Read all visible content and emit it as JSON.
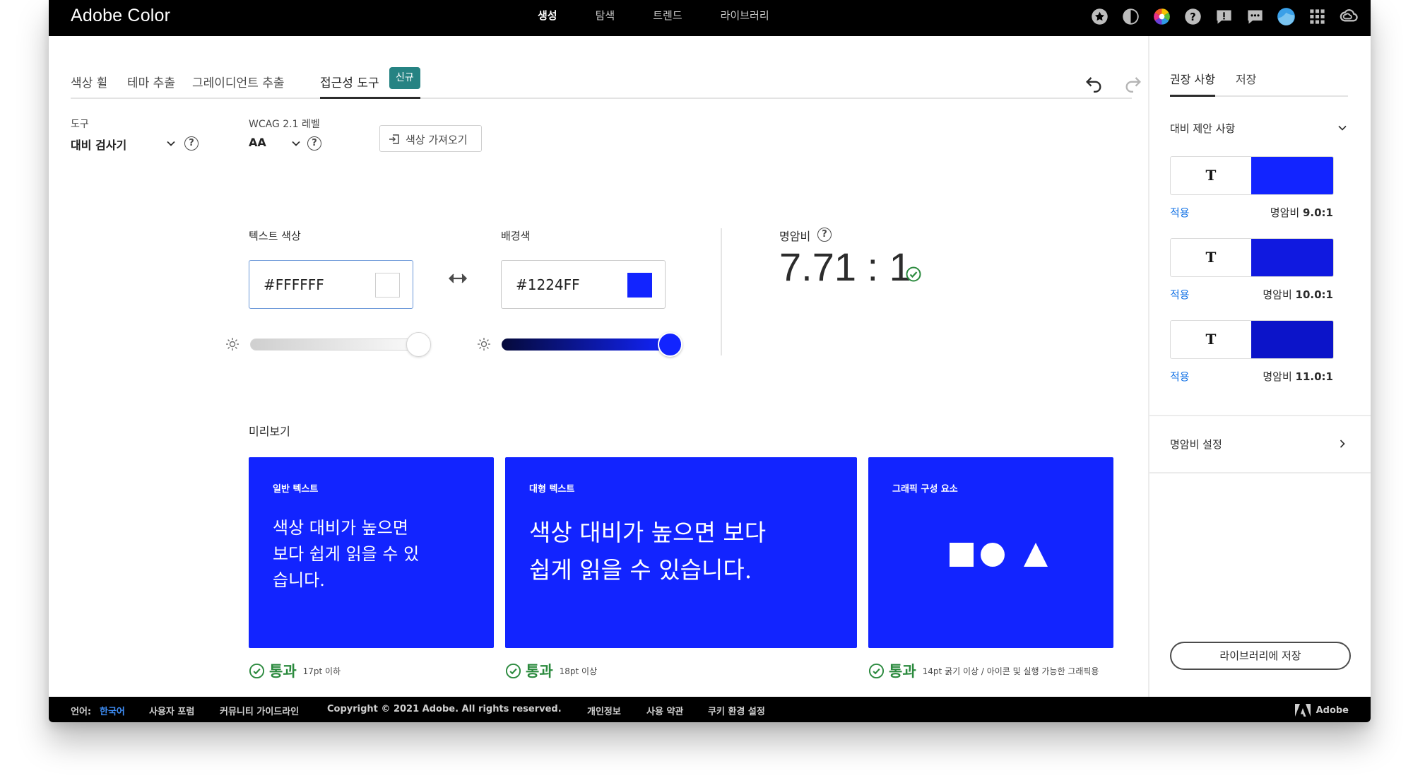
{
  "app": {
    "title": "Adobe Color"
  },
  "topnav": [
    "생성",
    "탐색",
    "트렌드",
    "라이브러리"
  ],
  "topicons": [
    "star-badge-icon",
    "contrast-icon",
    "color-wheel-icon",
    "help-icon",
    "feedback-alert-icon",
    "chat-icon",
    "avatar",
    "app-grid-icon",
    "creative-cloud-icon"
  ],
  "tabs": {
    "items": [
      "색상 휠",
      "테마 추출",
      "그레이디언트 추출",
      "접근성 도구"
    ],
    "new_badge": "신규"
  },
  "controls": {
    "tool_label": "도구",
    "tool_value": "대비 검사기",
    "wcag_label": "WCAG 2.1 레벨",
    "wcag_value": "AA",
    "import_label": "색상 가져오기"
  },
  "text_color": {
    "label": "텍스트 색상",
    "hex": "#FFFFFF",
    "brightness_level": 1.0
  },
  "bg_color": {
    "label": "배경색",
    "hex": "#1224FF",
    "brightness_level": 1.0
  },
  "contrast": {
    "label": "명암비",
    "value": "7.71 : 1"
  },
  "preview": {
    "label": "미리보기",
    "cards": [
      {
        "title": "일반 텍스트",
        "lines": [
          "색상 대비가 높으면",
          "보다 쉽게 읽을 수 있",
          "습니다."
        ]
      },
      {
        "title": "대형 텍스트",
        "lines": [
          "색상 대비가 높으면 보다",
          "쉽게 읽을 수 있습니다."
        ]
      },
      {
        "title": "그래픽 구성 요소"
      }
    ],
    "results": [
      {
        "status": "통과",
        "desc": "17pt 이하"
      },
      {
        "status": "통과",
        "desc": "18pt 이상"
      },
      {
        "status": "통과",
        "desc": "14pt 굵기 이상 / 아이콘 및 실행 가능한 그래픽용"
      }
    ]
  },
  "panel": {
    "tabs": [
      "권장 사항",
      "저장"
    ],
    "section_title": "대비 제안 사항",
    "suggestions": [
      {
        "letter": "T",
        "color": "#1224FF",
        "apply": "적용",
        "ratio_label": "명암비",
        "ratio": "9.0:1"
      },
      {
        "letter": "T",
        "color": "#1019E0",
        "apply": "적용",
        "ratio_label": "명암비",
        "ratio": "10.0:1"
      },
      {
        "letter": "T",
        "color": "#0C14C9",
        "apply": "적용",
        "ratio_label": "명암비",
        "ratio": "11.0:1"
      }
    ],
    "settings_label": "명암비 설정",
    "save_button": "라이브러리에 저장"
  },
  "footer": {
    "lang_label": "언어:",
    "lang_value": "한국어",
    "links": [
      "사용자 포럼",
      "커뮤니티 가이드라인",
      "Copyright © 2021 Adobe. All rights reserved.",
      "개인정보",
      "사용 약관",
      "쿠키 환경 설정"
    ],
    "brand": "Adobe"
  },
  "colors": {
    "accent_blue": "#1224FF",
    "pass_green": "#2b8a3e",
    "link_blue": "#1473e6",
    "badge_teal": "#268383"
  }
}
